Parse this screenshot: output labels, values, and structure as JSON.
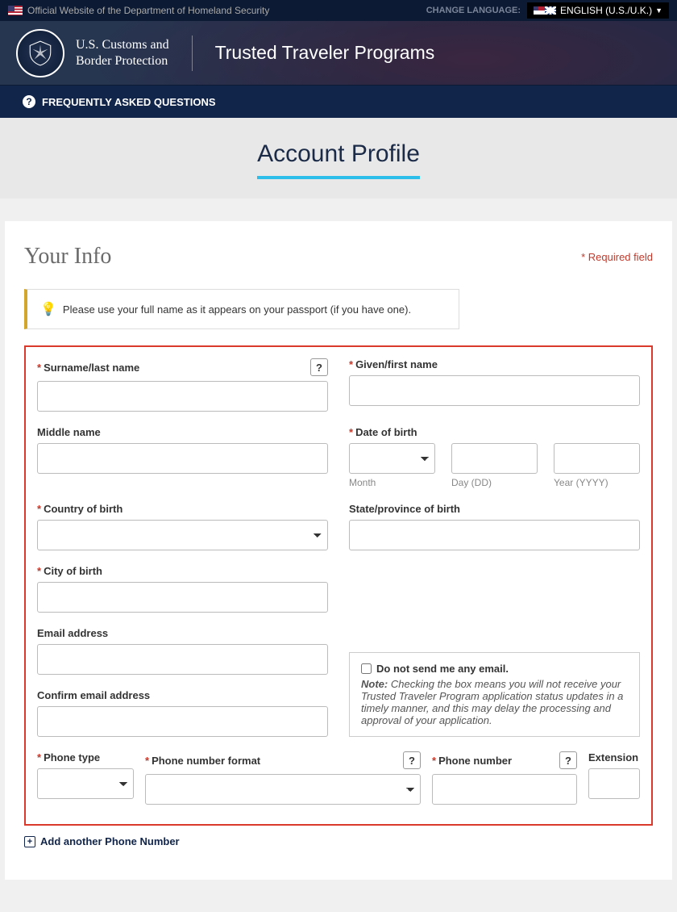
{
  "topbar": {
    "official_text": "Official Website of the Department of Homeland Security",
    "change_language_label": "CHANGE LANGUAGE:",
    "language_value": "ENGLISH (U.S./U.K.)"
  },
  "header": {
    "agency_line1": "U.S. Customs and",
    "agency_line2": "Border Protection",
    "program_title": "Trusted Traveler Programs"
  },
  "faq": {
    "label": "FREQUENTLY ASKED QUESTIONS"
  },
  "page": {
    "title": "Account Profile"
  },
  "section": {
    "title": "Your Info",
    "required_note": "Required field"
  },
  "tip": {
    "text": "Please use your full name as it appears on your passport (if you have one)."
  },
  "form": {
    "surname_label": "Surname/last name",
    "given_label": "Given/first name",
    "middle_label": "Middle name",
    "dob_label": "Date of birth",
    "dob_month": "Month",
    "dob_day": "Day (DD)",
    "dob_year": "Year (YYYY)",
    "country_label": "Country of birth",
    "state_label": "State/province of birth",
    "city_label": "City of birth",
    "email_label": "Email address",
    "confirm_email_label": "Confirm email address",
    "no_email_checkbox": "Do not send me any email.",
    "note_prefix": "Note:",
    "note_text": "Checking the box means you will not receive your Trusted Traveler Program application status updates in a timely manner, and this may delay the processing and approval of your application.",
    "phone_type_label": "Phone type",
    "phone_format_label": "Phone number format",
    "phone_number_label": "Phone number",
    "extension_label": "Extension",
    "add_phone_label": "Add another Phone Number",
    "help_q": "?"
  }
}
